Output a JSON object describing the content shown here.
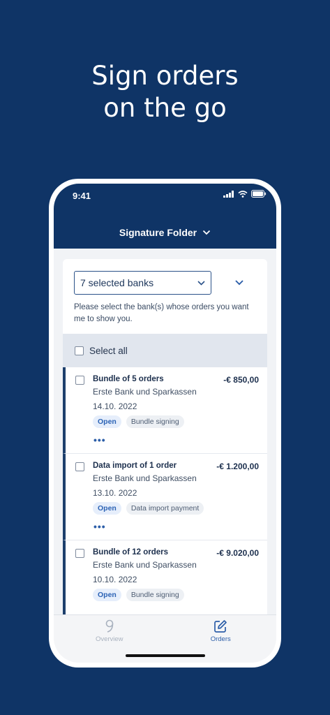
{
  "headline": {
    "line1": "Sign orders",
    "line2": "on the go"
  },
  "status_bar": {
    "time": "9:41"
  },
  "header": {
    "title": "Signature Folder"
  },
  "filter": {
    "select_value": "7 selected banks",
    "hint": "Please select the bank(s) whose orders you want me to show you."
  },
  "select_all_label": "Select all",
  "orders": [
    {
      "title": "Bundle of 5 orders",
      "amount": "-€ 850,00",
      "bank": "Erste Bank und Sparkassen",
      "date": "14.10. 2022",
      "status": "Open",
      "type": "Bundle signing",
      "more": "•••"
    },
    {
      "title": "Data import of 1 order",
      "amount": "-€ 1.200,00",
      "bank": "Erste Bank und Sparkassen",
      "date": "13.10. 2022",
      "status": "Open",
      "type": "Data import payment",
      "more": "•••"
    },
    {
      "title": "Bundle of 12 orders",
      "amount": "-€ 9.020,00",
      "bank": "Erste Bank und Sparkassen",
      "date": "10.10. 2022",
      "status": "Open",
      "type": "Bundle signing"
    }
  ],
  "tabs": [
    {
      "label": "Overview",
      "icon": "overview-icon",
      "active": false
    },
    {
      "label": "Orders",
      "icon": "edit-icon",
      "active": true
    }
  ],
  "colors": {
    "brand": "#0f3466",
    "accent": "#2c5ea8",
    "badge_open_bg": "#e6eefb"
  }
}
